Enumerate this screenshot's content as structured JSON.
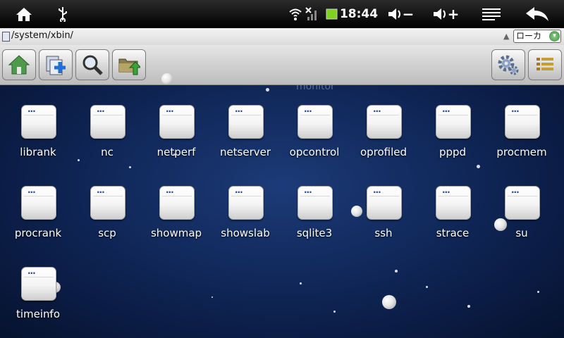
{
  "statusbar": {
    "time": "18:44",
    "home_icon": "home-icon",
    "usb_icon": "usb-icon",
    "wifi_icon": "wifi-icon",
    "signal_icon": "no-signal-icon",
    "battery_icon": "battery-icon",
    "battery_color": "#7ed321",
    "vol_down_symbol": "−",
    "vol_up_symbol": "+",
    "menu_icon": "menu-icon",
    "back_icon": "back-icon"
  },
  "pathbar": {
    "path": "/system/xbin/",
    "location": "ローカ",
    "location_icon": "dropdown-icon"
  },
  "toolbar": {
    "buttons": [
      {
        "icon": "home-icon"
      },
      {
        "icon": "new-folder-icon"
      },
      {
        "icon": "search-icon"
      },
      {
        "icon": "folder-up-icon"
      },
      {
        "icon": "gear-icon"
      },
      {
        "icon": "list-view-icon"
      }
    ]
  },
  "background_label": "monitor",
  "files": [
    "librank",
    "nc",
    "netperf",
    "netserver",
    "opcontrol",
    "oprofiled",
    "pppd",
    "procmem",
    "procrank",
    "scp",
    "showmap",
    "showslab",
    "sqlite3",
    "ssh",
    "strace",
    "su",
    "timeinfo"
  ],
  "folder_dots": "..."
}
